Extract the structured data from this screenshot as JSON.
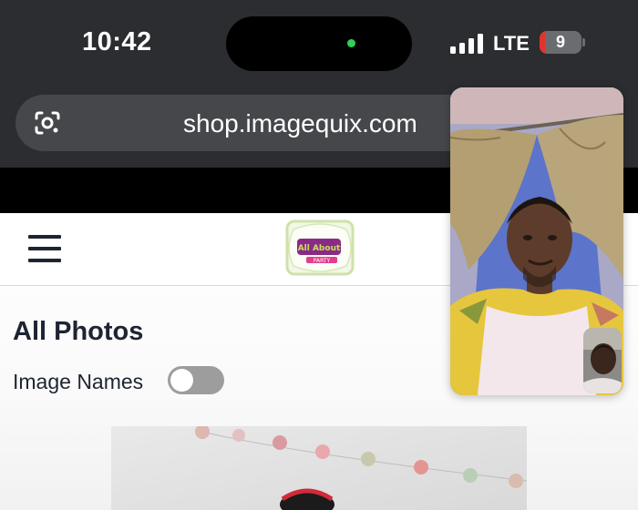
{
  "status_bar": {
    "time": "10:42",
    "network": "LTE",
    "battery_level": "9",
    "signal_bars": 4,
    "camera_indicator_color": "#2fd158",
    "battery_low_color": "#e0342c"
  },
  "browser": {
    "url": "shop.imagequix.com",
    "lens_icon": "google-lens-icon"
  },
  "site": {
    "menu_icon": "hamburger-menu-icon",
    "logo_text": "All About Party",
    "page_title": "All Photos",
    "toggle_label": "Image Names",
    "toggle_state": "off"
  },
  "facetime": {
    "remote_video": "video call participant",
    "self_view": "self view thumbnail"
  }
}
